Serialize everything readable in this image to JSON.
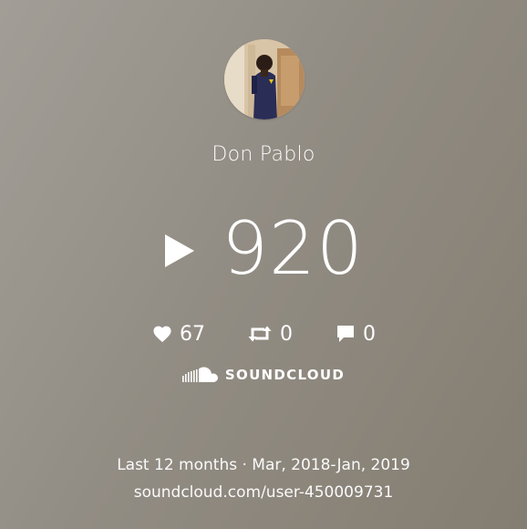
{
  "profile": {
    "name": "Don Pablo"
  },
  "plays": {
    "count": "920"
  },
  "stats": {
    "likes": "67",
    "reposts": "0",
    "comments": "0"
  },
  "brand": {
    "name": "SOUNDCLOUD"
  },
  "footer": {
    "period": "Last 12 months · Mar, 2018-Jan, 2019",
    "profile_url": "soundcloud.com/user-450009731"
  },
  "icons": {
    "play": "play-icon",
    "heart": "heart-icon",
    "repost": "repost-icon",
    "comment": "comment-icon",
    "logo": "soundcloud-logo-icon"
  },
  "colors": {
    "text": "#ffffff",
    "background": "#928d84"
  }
}
